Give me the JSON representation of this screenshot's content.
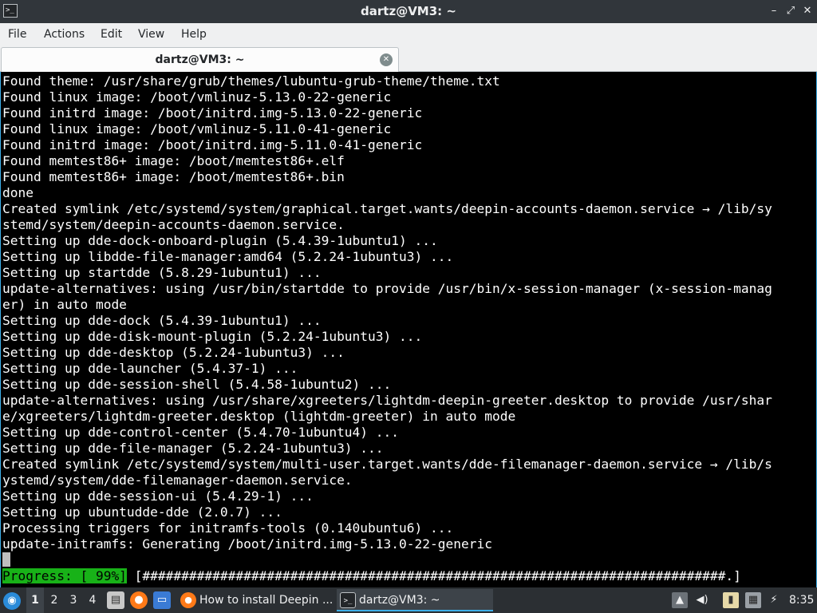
{
  "window": {
    "title": "dartz@VM3: ~",
    "app_icon": "terminal-icon",
    "app_icon_glyph": ">_",
    "buttons": {
      "minimize": "–",
      "maximize": "⤢",
      "close": "✕"
    }
  },
  "menu": {
    "items": [
      "File",
      "Actions",
      "Edit",
      "View",
      "Help"
    ]
  },
  "tab": {
    "label": "dartz@VM3: ~",
    "close_glyph": "✕"
  },
  "terminal": {
    "lines": [
      "Found theme: /usr/share/grub/themes/lubuntu-grub-theme/theme.txt",
      "Found linux image: /boot/vmlinuz-5.13.0-22-generic",
      "Found initrd image: /boot/initrd.img-5.13.0-22-generic",
      "Found linux image: /boot/vmlinuz-5.11.0-41-generic",
      "Found initrd image: /boot/initrd.img-5.11.0-41-generic",
      "Found memtest86+ image: /boot/memtest86+.elf",
      "Found memtest86+ image: /boot/memtest86+.bin",
      "done",
      "Created symlink /etc/systemd/system/graphical.target.wants/deepin-accounts-daemon.service → /lib/sy",
      "stemd/system/deepin-accounts-daemon.service.",
      "Setting up dde-dock-onboard-plugin (5.4.39-1ubuntu1) ...",
      "Setting up libdde-file-manager:amd64 (5.2.24-1ubuntu3) ...",
      "Setting up startdde (5.8.29-1ubuntu1) ...",
      "update-alternatives: using /usr/bin/startdde to provide /usr/bin/x-session-manager (x-session-manag",
      "er) in auto mode",
      "Setting up dde-dock (5.4.39-1ubuntu1) ...",
      "Setting up dde-disk-mount-plugin (5.2.24-1ubuntu3) ...",
      "Setting up dde-desktop (5.2.24-1ubuntu3) ...",
      "Setting up dde-launcher (5.4.37-1) ...",
      "Setting up dde-session-shell (5.4.58-1ubuntu2) ...",
      "update-alternatives: using /usr/share/xgreeters/lightdm-deepin-greeter.desktop to provide /usr/shar",
      "e/xgreeters/lightdm-greeter.desktop (lightdm-greeter) in auto mode",
      "Setting up dde-control-center (5.4.70-1ubuntu4) ...",
      "Setting up dde-file-manager (5.2.24-1ubuntu3) ...",
      "Created symlink /etc/systemd/system/multi-user.target.wants/dde-filemanager-daemon.service → /lib/s",
      "ystemd/system/dde-filemanager-daemon.service.",
      "Setting up dde-session-ui (5.4.29-1) ...",
      "Setting up ubuntudde-dde (2.0.7) ...",
      "Processing triggers for initramfs-tools (0.140ubuntu6) ...",
      "update-initramfs: Generating /boot/initrd.img-5.13.0-22-generic"
    ],
    "progress_label": "Progress: [ 99%]",
    "progress_bar": " [###########################################################################.]",
    "progress_percent": 99,
    "colors": {
      "background": "#000000",
      "foreground": "#ffffff",
      "progress_bg": "#18b218"
    }
  },
  "taskbar": {
    "start_icon": "lubuntu-start-icon",
    "workspaces": [
      "1",
      "2",
      "3",
      "4"
    ],
    "active_workspace": "1",
    "quicklaunch": [
      "file-manager-icon",
      "firefox-icon",
      "desktop-icon"
    ],
    "tasks": [
      {
        "label": "How to install Deepin ...",
        "icon": "firefox-icon"
      },
      {
        "label": "dartz@VM3: ~",
        "icon": "terminal-icon"
      }
    ],
    "tray": [
      "update-icon",
      "volume-icon",
      "clipboard-icon",
      "network-icon",
      "power-icon"
    ],
    "clock": "8:35"
  }
}
